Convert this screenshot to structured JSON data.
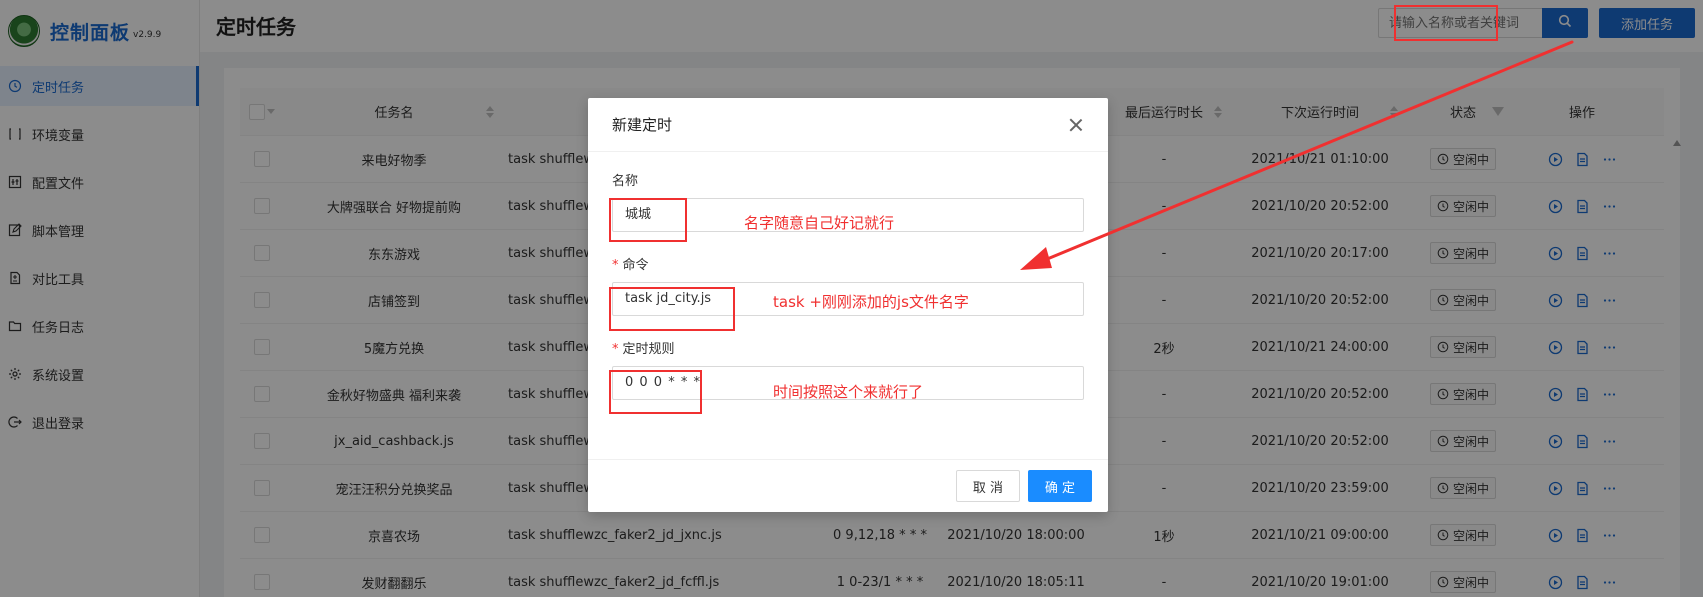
{
  "app": {
    "title": "控制面板",
    "version": "v2.9.9"
  },
  "sidebar": {
    "items": [
      {
        "label": "定时任务",
        "icon": "clock-icon",
        "active": true
      },
      {
        "label": "环境变量",
        "icon": "variable-icon",
        "active": false
      },
      {
        "label": "配置文件",
        "icon": "config-icon",
        "active": false
      },
      {
        "label": "脚本管理",
        "icon": "edit-icon",
        "active": false
      },
      {
        "label": "对比工具",
        "icon": "diff-icon",
        "active": false
      },
      {
        "label": "任务日志",
        "icon": "folder-icon",
        "active": false
      },
      {
        "label": "系统设置",
        "icon": "gear-icon",
        "active": false
      },
      {
        "label": "退出登录",
        "icon": "logout-icon",
        "active": false
      }
    ]
  },
  "header": {
    "page_title": "定时任务",
    "search_placeholder": "请输入名称或者关键词",
    "add_button": "添加任务"
  },
  "table": {
    "columns": {
      "name": "任务名",
      "last_duration": "最后运行时长",
      "next_run": "下次运行时间",
      "status": "状态",
      "actions": "操作"
    },
    "rows": [
      {
        "name": "来电好物季",
        "command": "task shufflewzc_fak",
        "schedule": "",
        "last_run": "",
        "duration": "-",
        "next_run": "2021/10/21 01:10:00",
        "status": "空闲中"
      },
      {
        "name": "大牌强联合 好物提前购",
        "command": "task shufflewzc_fak",
        "schedule": "",
        "last_run": "",
        "duration": "-",
        "next_run": "2021/10/20 20:52:00",
        "status": "空闲中"
      },
      {
        "name": "东东游戏",
        "command": "task shufflewzc_fak",
        "schedule": "",
        "last_run": "",
        "duration": "-",
        "next_run": "2021/10/20 20:17:00",
        "status": "空闲中"
      },
      {
        "name": "店铺签到",
        "command": "task shufflewzc_fak",
        "schedule": "",
        "last_run": "",
        "duration": "-",
        "next_run": "2021/10/20 20:52:00",
        "status": "空闲中"
      },
      {
        "name": "5魔方兑换",
        "command": "task shufflewzc_fak",
        "schedule": "",
        "last_run": "",
        "duration": "2秒",
        "next_run": "2021/10/21 24:00:00",
        "status": "空闲中"
      },
      {
        "name": "金秋好物盛典 福利来袭",
        "command": "task shufflewzc_fak",
        "schedule": "",
        "last_run": "",
        "duration": "-",
        "next_run": "2021/10/20 20:52:00",
        "status": "空闲中"
      },
      {
        "name": "jx_aid_cashback.js",
        "command": "task shufflewzc_fak",
        "schedule": "",
        "last_run": "",
        "duration": "-",
        "next_run": "2021/10/20 20:52:00",
        "status": "空闲中"
      },
      {
        "name": "宠汪汪积分兑换奖品",
        "command": "task shufflewzc_fak",
        "schedule": "",
        "last_run": "",
        "duration": "-",
        "next_run": "2021/10/20 23:59:00",
        "status": "空闲中"
      },
      {
        "name": "京喜农场",
        "command": "task shufflewzc_faker2_jd_jxnc.js",
        "schedule": "0 9,12,18 * * *",
        "last_run": "2021/10/20 18:00:00",
        "duration": "1秒",
        "next_run": "2021/10/21 09:00:00",
        "status": "空闲中"
      },
      {
        "name": "发财翻翻乐",
        "command": "task shufflewzc_faker2_jd_fcffl.js",
        "schedule": "1 0-23/1 * * *",
        "last_run": "2021/10/20 18:05:11",
        "duration": "-",
        "next_run": "2021/10/20 19:01:00",
        "status": "空闲中"
      }
    ]
  },
  "modal": {
    "title": "新建定时",
    "name_label": "名称",
    "name_value": "城城",
    "command_label": "命令",
    "command_value": "task jd_city.js",
    "schedule_label": "定时规则",
    "schedule_value": "0 0 0 * * *",
    "cancel": "取 消",
    "ok": "确 定"
  },
  "annotations": {
    "name_hint": "名字随意自己好记就行",
    "command_hint": "task +刚刚添加的js文件名字",
    "schedule_hint": "时间按照这个来就行了"
  },
  "colors": {
    "primary": "#1a6ad0",
    "annotation": "#f03030"
  }
}
